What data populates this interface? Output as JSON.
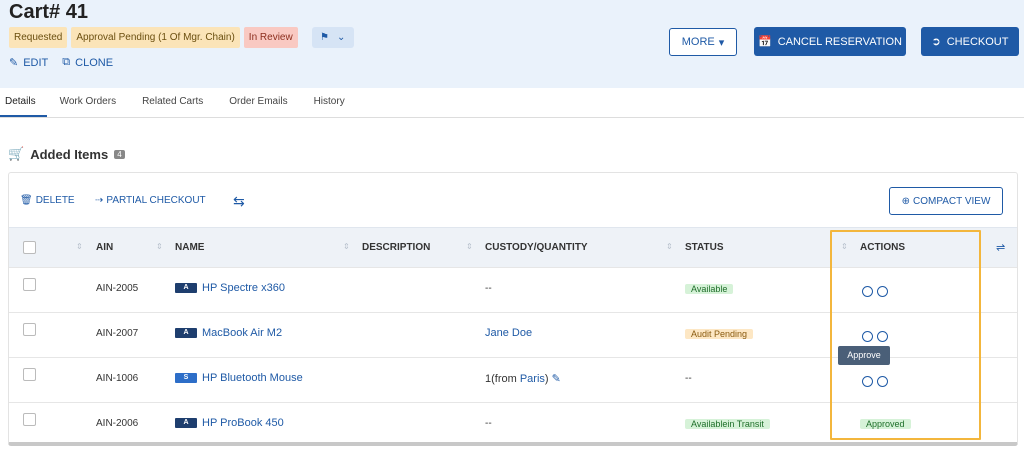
{
  "header": {
    "cart_title": "Cart# 41",
    "badges": [
      "Requested",
      "Approval Pending (1 Of Mgr. Chain)",
      "In Review"
    ],
    "edit_label": "EDIT",
    "clone_label": "CLONE",
    "more_label": "MORE",
    "cancel_label": "CANCEL RESERVATION",
    "checkout_label": "CHECKOUT"
  },
  "tabs": [
    "Details",
    "Work Orders",
    "Related Carts",
    "Order Emails",
    "History"
  ],
  "section": {
    "title": "Added Items",
    "count": "4"
  },
  "toolbar": {
    "delete_label": "DELETE",
    "partial_checkout_label": "PARTIAL CHECKOUT",
    "compact_view_label": "COMPACT VIEW"
  },
  "table": {
    "columns": [
      "AIN",
      "NAME",
      "DESCRIPTION",
      "CUSTODY/QUANTITY",
      "STATUS",
      "ACTIONS"
    ],
    "rows": [
      {
        "ain": "AIN-2005",
        "type": "A",
        "name": "HP Spectre x360",
        "custody": "--",
        "status": "Available",
        "action": "icons"
      },
      {
        "ain": "AIN-2007",
        "type": "A",
        "name": "MacBook Air M2",
        "custody": "Jane Doe",
        "status": "Audit Pending",
        "action": "icons"
      },
      {
        "ain": "AIN-1006",
        "type": "S",
        "name": "HP Bluetooth Mouse",
        "custody_prefix": "1(from ",
        "custody_link": "Paris",
        "custody_suffix": ")",
        "status": "--",
        "action": "icons"
      },
      {
        "ain": "AIN-2006",
        "type": "A",
        "name": "HP ProBook 450",
        "custody": "--",
        "status": "Availablein Transit",
        "action": "Approved"
      }
    ]
  },
  "tooltip": "Approve",
  "colors": {
    "primary": "#1f5aa6",
    "header_bg": "#eaf2fb",
    "highlight": "#f3b63c"
  }
}
